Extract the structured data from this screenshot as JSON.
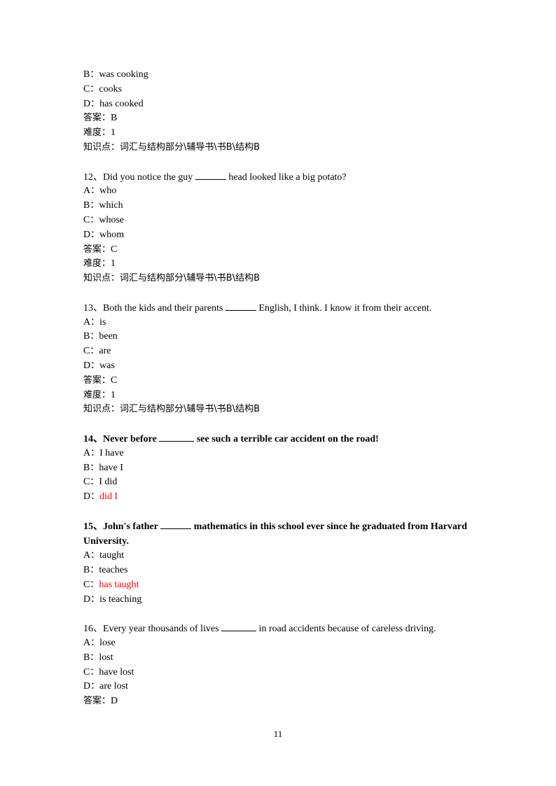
{
  "carryover": {
    "options": [
      {
        "letter": "B",
        "text": "was cooking",
        "highlight": false
      },
      {
        "letter": "C",
        "text": "cooks",
        "highlight": false
      },
      {
        "letter": "D",
        "text": "has cooked",
        "highlight": false
      }
    ],
    "answer_label": "答案：",
    "answer": "B",
    "difficulty_label": "难度：",
    "difficulty": "1",
    "knowledge_label": "知识点：",
    "knowledge": "词汇与结构部分\\辅导书\\书B\\结构B"
  },
  "questions": [
    {
      "number": "12、",
      "stem_before": "Did you notice the guy ",
      "stem_after": " head looked like a big potato?",
      "options": [
        {
          "letter": "A",
          "text": "who"
        },
        {
          "letter": "B",
          "text": "which"
        },
        {
          "letter": "C",
          "text": "whose"
        },
        {
          "letter": "D",
          "text": "whom"
        }
      ],
      "answer_label": "答案：",
      "answer": "C",
      "difficulty_label": "难度：",
      "difficulty": "1",
      "knowledge_label": "知识点：",
      "knowledge": "词汇与结构部分\\辅导书\\书B\\结构B"
    },
    {
      "number": "13、",
      "stem_before": "Both the kids and their parents ",
      "stem_after": " English, I think. I know it from their accent.",
      "options": [
        {
          "letter": "A",
          "text": "is"
        },
        {
          "letter": "B",
          "text": "been"
        },
        {
          "letter": "C",
          "text": "are"
        },
        {
          "letter": "D",
          "text": "was"
        }
      ],
      "answer_label": "答案：",
      "answer": "C",
      "difficulty_label": "难度：",
      "difficulty": "1",
      "knowledge_label": "知识点：",
      "knowledge": "词汇与结构部分\\辅导书\\书B\\结构B"
    },
    {
      "number": "14、",
      "stem_before": "Never before ",
      "stem_after": " see such a terrible car accident on the road!",
      "bold": true,
      "options": [
        {
          "letter": "A",
          "text": "I have"
        },
        {
          "letter": "B",
          "text": "have I"
        },
        {
          "letter": "C",
          "text": "I did"
        },
        {
          "letter": "D",
          "text": "did I",
          "highlight": true
        }
      ]
    },
    {
      "number": "15、",
      "stem_before": "John's father ",
      "stem_after": " mathematics in this school ever since he graduated from Harvard University.",
      "bold": true,
      "options": [
        {
          "letter": "A",
          "text": "taught"
        },
        {
          "letter": "B",
          "text": "teaches"
        },
        {
          "letter": "C",
          "text": "has taught",
          "highlight": true
        },
        {
          "letter": "D",
          "text": "is teaching"
        }
      ]
    },
    {
      "number": "16、",
      "stem_before": "Every year thousands of lives ",
      "stem_after": " in road accidents because of careless driving.",
      "options": [
        {
          "letter": "A",
          "text": "lose"
        },
        {
          "letter": "B",
          "text": "lost"
        },
        {
          "letter": "C",
          "text": "have lost"
        },
        {
          "letter": "D",
          "text": "are lost"
        }
      ],
      "answer_label": "答案：",
      "answer": "D"
    }
  ],
  "option_separator": "：",
  "highlight_color": "#ff0000",
  "page_number": "11"
}
